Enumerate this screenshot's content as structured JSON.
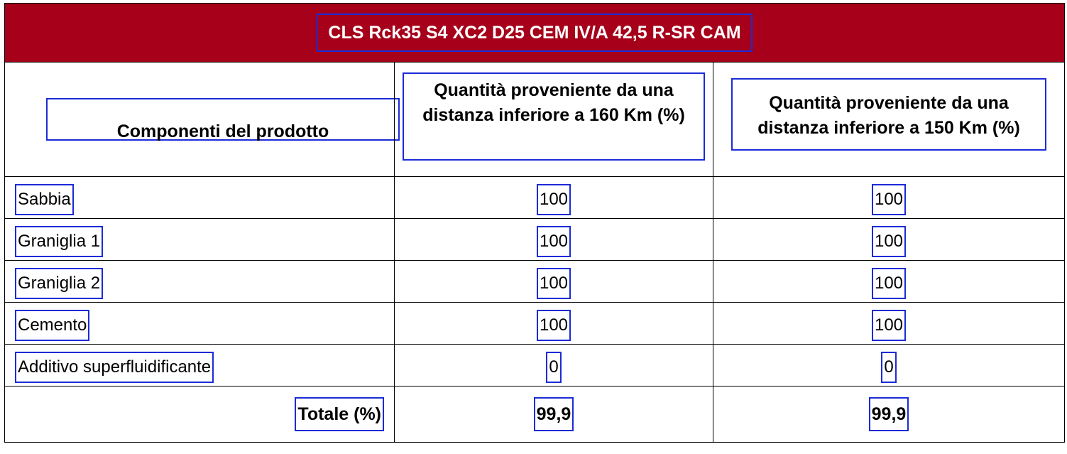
{
  "title": "CLS Rck35 S4 XC2 D25 CEM IV/A 42,5 R-SR CAM",
  "headers": {
    "components": "Componenti del prodotto",
    "distance_160": "Quantità proveniente da una distanza inferiore a 160 Km (%)",
    "distance_150": "Quantità proveniente da una distanza inferiore a 150 Km (%)"
  },
  "rows": [
    {
      "name": "Sabbia",
      "d160": "100",
      "d150": "100"
    },
    {
      "name": "Graniglia 1",
      "d160": "100",
      "d150": "100"
    },
    {
      "name": "Graniglia 2",
      "d160": "100",
      "d150": "100"
    },
    {
      "name": "Cemento",
      "d160": "100",
      "d150": "100"
    },
    {
      "name": "Additivo superfluidificante",
      "d160": "0",
      "d150": "0"
    }
  ],
  "total": {
    "label": "Totale (%)",
    "d160": "99,9",
    "d150": "99,9"
  },
  "colors": {
    "title_background": "#a6001a",
    "title_text": "#ffffff",
    "annotation_box": "#1b2bd6"
  }
}
